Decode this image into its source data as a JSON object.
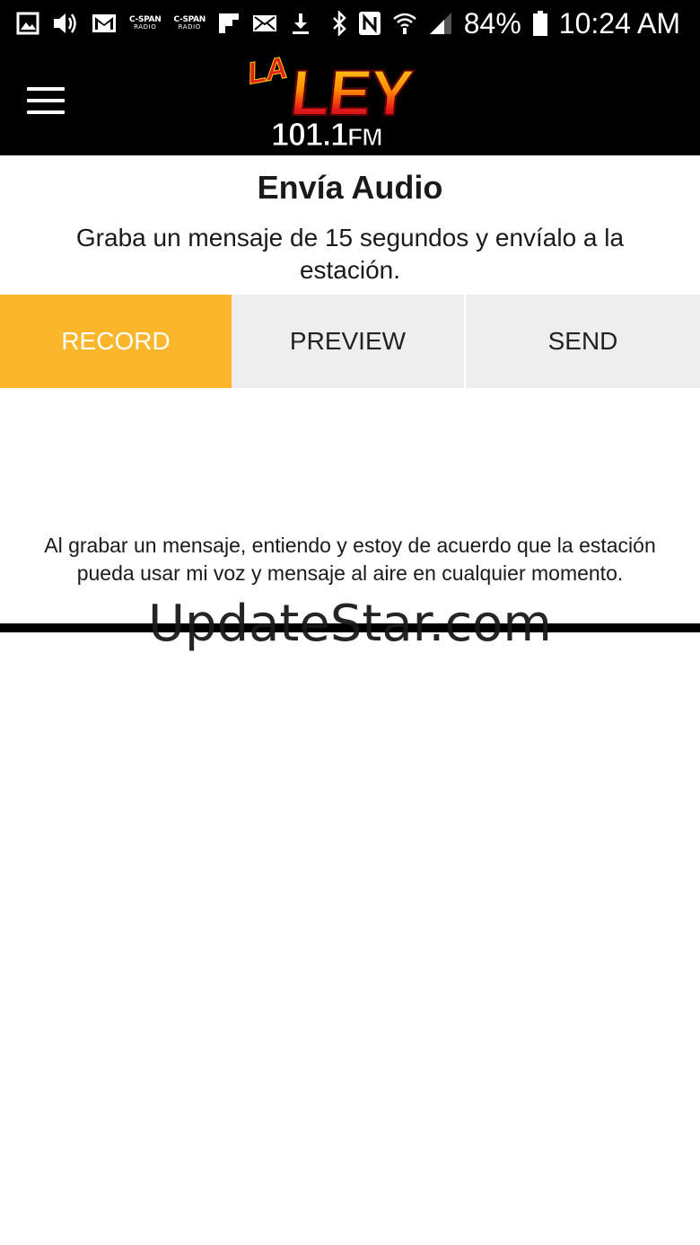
{
  "status_bar": {
    "icons_left": [
      "image-icon",
      "volume-icon",
      "gmail-icon",
      "cspan-radio-icon",
      "cspan-radio-icon",
      "flipboard-icon",
      "mail-icon",
      "download-icon"
    ],
    "cspan_top": "C-SPAN",
    "cspan_bottom": "RADIO",
    "icons_right": [
      "bluetooth-icon",
      "nfc-icon",
      "wifi-icon",
      "signal-icon",
      "battery-icon"
    ],
    "battery": "84%",
    "time": "10:24 AM"
  },
  "app_bar": {
    "menu_icon": "hamburger-menu-icon",
    "logo": {
      "la": "LA",
      "ley": "LEY",
      "freq": "101.1",
      "band": "FM"
    }
  },
  "page": {
    "title": "Envía Audio",
    "subtitle": "Graba un mensaje de 15 segundos y envíalo a la estación.",
    "tabs": [
      {
        "label": "RECORD",
        "active": true
      },
      {
        "label": "PREVIEW",
        "active": false
      },
      {
        "label": "SEND",
        "active": false
      }
    ],
    "disclaimer": "Al grabar un mensaje, entiendo y estoy de acuerdo que la estación pueda usar mi voz y mensaje al aire en cualquier momento."
  },
  "watermark": "UpdateStar.com",
  "colors": {
    "accent": "#fbb62b",
    "tab_inactive": "#eeeeee",
    "bar_background": "#000000"
  }
}
